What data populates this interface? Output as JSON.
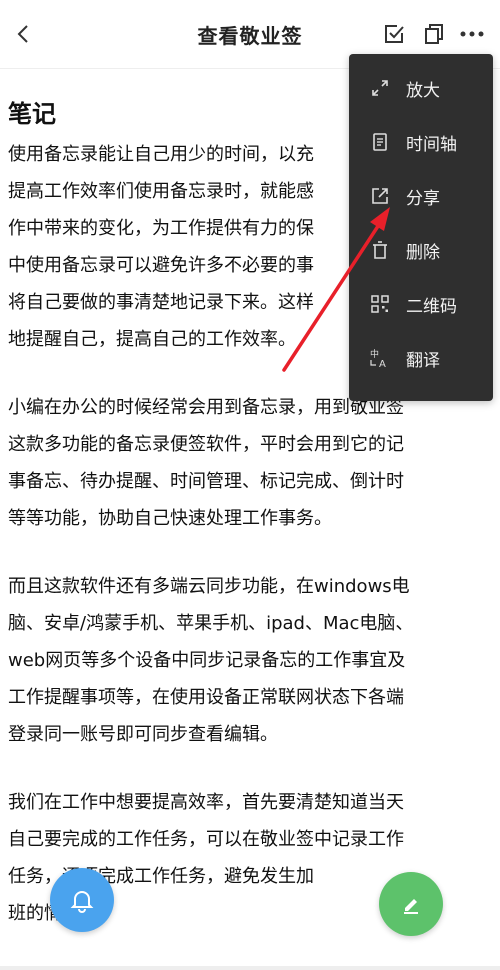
{
  "header": {
    "title": "查看敬业签"
  },
  "note": {
    "heading": "笔记",
    "paragraphs": [
      "使用备忘录能让自己用少的时间，以充\n提高工作效率们使用备忘录时，就能感\n作中带来的变化，为工作提供有力的保\n中使用备忘录可以避免许多不必要的事\n将自己要做的事清楚地记录下来。这样\n地提醒自己，提高自己的工作效率。",
      "小编在办公的时候经常会用到备忘录，用到敬业签\n这款多功能的备忘录便签软件，平时会用到它的记\n事备忘、待办提醒、时间管理、标记完成、倒计时\n等等功能，协助自己快速处理工作事务。",
      "而且这款软件还有多端云同步功能，在windows电\n脑、安卓/鸿蒙手机、苹果手机、ipad、Mac电脑、\nweb网页等多个设备中同步记录备忘的工作事宜及\n工作提醒事项等，在使用设备正常联网状态下各端\n登录同一账号即可同步查看编辑。",
      "我们在工作中想要提高效率，首先要清楚知道当天\n自己要完成的工作任务，可以在敬业签中记录工作\n任务，逐项完成工作任务，避免发生加\n班的情况。"
    ]
  },
  "menu": {
    "items": [
      {
        "label": "放大",
        "icon": "expand-icon"
      },
      {
        "label": "时间轴",
        "icon": "document-icon"
      },
      {
        "label": "分享",
        "icon": "share-icon"
      },
      {
        "label": "删除",
        "icon": "trash-icon"
      },
      {
        "label": "二维码",
        "icon": "qrcode-icon"
      },
      {
        "label": "翻译",
        "icon": "translate-icon"
      }
    ]
  },
  "colors": {
    "menu_bg": "#2f2f2f",
    "annotation_arrow": "#e8202a",
    "fab_bell": "#4aa3ee",
    "fab_edit": "#5dc26b"
  }
}
